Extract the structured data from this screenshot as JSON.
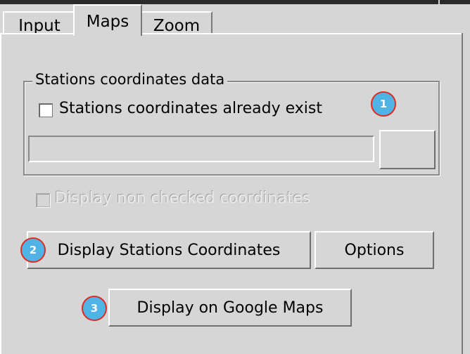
{
  "tabs": [
    {
      "label": "Input",
      "active": false
    },
    {
      "label": "Maps",
      "active": true
    },
    {
      "label": "Zoom",
      "active": false
    }
  ],
  "stations_group": {
    "legend": "Stations coordinates data",
    "exist_checkbox": {
      "label": "Stations coordinates already exist",
      "checked": false
    },
    "path_field": {
      "value": ""
    },
    "browse_button": {
      "label": ""
    }
  },
  "non_checked_checkbox": {
    "label": "Display non checked coordinates",
    "checked": false,
    "enabled": false
  },
  "buttons": {
    "display_coords": "Display Stations Coordinates",
    "options": "Options",
    "google_maps": "Display on Google Maps"
  },
  "badges": {
    "b1": "1",
    "b2": "2",
    "b3": "3"
  },
  "colors": {
    "background": "#d6d6d6",
    "badge_fill": "#4fb3e6",
    "badge_border": "#e02a1f"
  }
}
